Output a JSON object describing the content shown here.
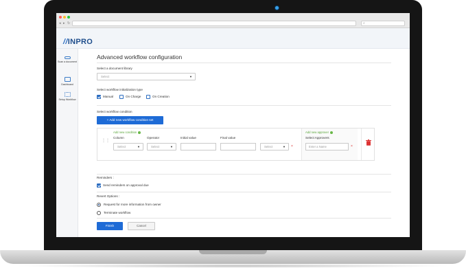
{
  "browser": {
    "url": "",
    "search_placeholder": ""
  },
  "app": {
    "logo_text": "INPRO"
  },
  "sidebar": {
    "items": [
      {
        "label": "Scan a document"
      },
      {
        "label": "Dashboard"
      },
      {
        "label": "Setup Workflow"
      }
    ]
  },
  "page": {
    "title": "Advanced workflow configuration"
  },
  "library": {
    "label": "Select a document library",
    "value": "Select"
  },
  "init_type": {
    "label": "Select workflow initialization type",
    "options": [
      {
        "label": "Manual",
        "checked": true
      },
      {
        "label": "On Charge",
        "checked": false
      },
      {
        "label": "On Creation",
        "checked": false
      }
    ]
  },
  "condition": {
    "label": "Select workflow condition",
    "add_set_button": "Add new workflow condition set",
    "add_condition": "Add new condition",
    "add_approver": "Add new approver",
    "columns": {
      "column": "Column",
      "operator": "Operator",
      "initial": "Initial value",
      "final": "Final value",
      "approvers": "Select Approvers"
    },
    "column_value": "Select",
    "operator_value": "Select",
    "extra_value": "Select",
    "approver_placeholder": "Enter a Name",
    "remove_glyph": "×"
  },
  "reminders": {
    "label": "Reminders :",
    "option": "Send reminders on approval due",
    "checked": true
  },
  "revert": {
    "label": "Revert Options :",
    "options": [
      {
        "label": "Request for more information from owner",
        "selected": true
      },
      {
        "label": "Terminate workflow",
        "selected": false
      }
    ]
  },
  "actions": {
    "finish": "Finish",
    "cancel": "Cancel"
  },
  "colors": {
    "primary": "#1e6bd6",
    "brand": "#1f4e8c",
    "success": "#69b848",
    "danger": "#d33333"
  }
}
